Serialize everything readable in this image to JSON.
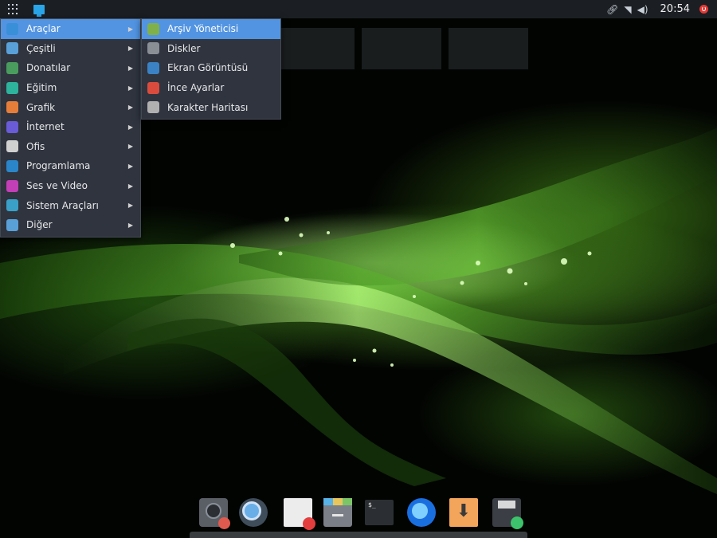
{
  "topbar": {
    "apps_icon": "apps-grid-icon",
    "clock": "20:54",
    "tray_icons": [
      "link-icon",
      "wifi-icon",
      "volume-icon"
    ],
    "power_icon": "power-icon",
    "power_color": "#e53935"
  },
  "colors": {
    "menu_bg": "#2f343f",
    "menu_highlight": "#5294e2",
    "panel_bg": "#1b1f24"
  },
  "menu": {
    "categories": [
      {
        "label": "Araçlar",
        "icon": "tools-icon",
        "active": true
      },
      {
        "label": "Çeşitli",
        "icon": "misc-icon"
      },
      {
        "label": "Donatılar",
        "icon": "accessories-icon"
      },
      {
        "label": "Eğitim",
        "icon": "education-icon"
      },
      {
        "label": "Grafik",
        "icon": "graphics-icon"
      },
      {
        "label": "İnternet",
        "icon": "internet-icon"
      },
      {
        "label": "Ofis",
        "icon": "office-icon"
      },
      {
        "label": "Programlama",
        "icon": "programming-icon"
      },
      {
        "label": "Ses ve Video",
        "icon": "multimedia-icon"
      },
      {
        "label": "Sistem Araçları",
        "icon": "system-tools-icon"
      },
      {
        "label": "Diğer",
        "icon": "other-icon"
      }
    ],
    "submenu": [
      {
        "label": "Arşiv Yöneticisi",
        "icon": "archive-manager-icon",
        "active": true
      },
      {
        "label": "Diskler",
        "icon": "disks-icon"
      },
      {
        "label": "Ekran Görüntüsü",
        "icon": "screenshot-icon"
      },
      {
        "label": "İnce Ayarlar",
        "icon": "tweaks-icon"
      },
      {
        "label": "Karakter Haritası",
        "icon": "character-map-icon"
      }
    ]
  },
  "dock": {
    "items": [
      {
        "name": "disk-utility-icon"
      },
      {
        "name": "chromium-icon"
      },
      {
        "name": "text-editor-icon"
      },
      {
        "name": "file-manager-icon"
      },
      {
        "name": "terminal-icon",
        "text": "$_"
      },
      {
        "name": "firefox-icon"
      },
      {
        "name": "download-manager-icon",
        "text": "⬇"
      },
      {
        "name": "software-installer-icon"
      }
    ]
  }
}
